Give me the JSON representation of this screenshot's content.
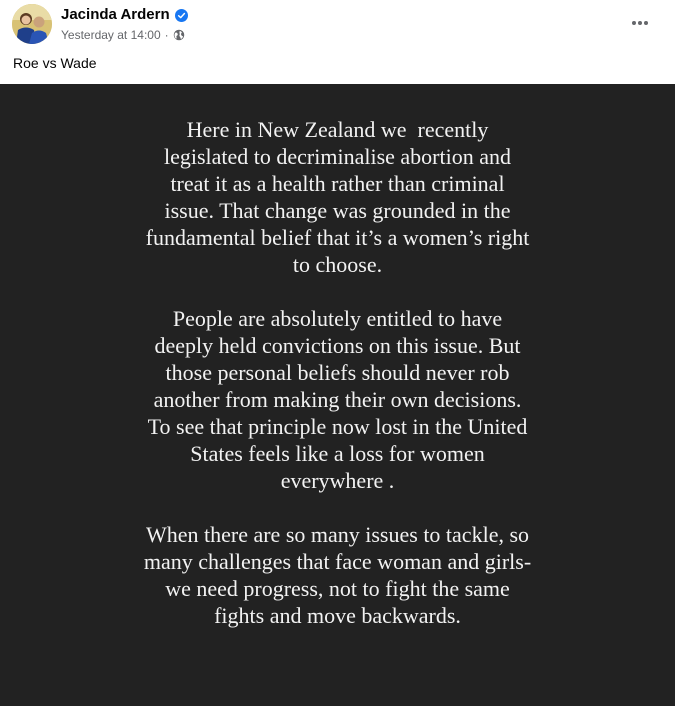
{
  "post": {
    "author": "Jacinda Ardern",
    "timestamp": "Yesterday at 14:00",
    "separator": "·",
    "caption": "Roe vs Wade",
    "icons": {
      "verified": "verified-badge-icon",
      "audience": "globe-icon",
      "more": "more-options-icon"
    },
    "colors": {
      "verified": "#1877f2",
      "story_background": "#222222",
      "story_text": "#f2f2f2"
    }
  },
  "story": {
    "paragraphs": [
      {
        "lines": [
          "Here in New Zealand we  recently",
          "legislated to decriminalise abortion and",
          "treat it as a health rather than criminal",
          "issue. That change was grounded in the",
          "fundamental belief that it’s a women’s right",
          "to choose."
        ]
      },
      {
        "lines": [
          "People are absolutely entitled to have",
          "deeply held convictions on this issue. But",
          "those personal beliefs should never rob",
          "another from making their own decisions.",
          "To see that principle now lost in the United",
          "States feels like a loss for women",
          "everywhere ."
        ]
      },
      {
        "lines": [
          "When there are so many issues to tackle, so",
          "many challenges that face woman and girls-",
          "we need progress, not to fight the same",
          "fights and move backwards."
        ]
      }
    ]
  }
}
